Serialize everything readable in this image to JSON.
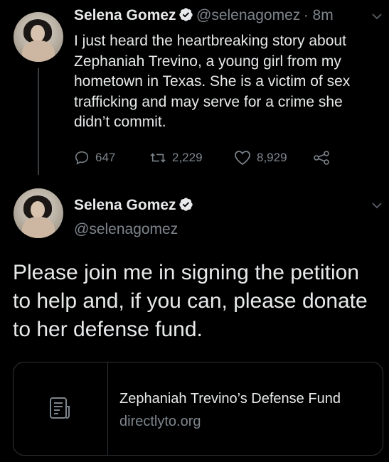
{
  "tweet1": {
    "author_name": "Selena Gomez",
    "handle": "@selenagomez",
    "time": "· 8m",
    "text": "I just heard the heartbreaking story about Zephaniah Trevino, a young girl from my hometown in Texas. She is a victim of sex trafficking and may serve for a crime she didn’t commit.",
    "replies": "647",
    "retweets": "2,229",
    "likes": "8,929"
  },
  "tweet2": {
    "author_name": "Selena Gomez",
    "handle": "@selenagomez",
    "text": "Please join me in signing the petition to help and, if you can, please donate to her defense fund.",
    "card": {
      "title": "Zephaniah Trevino’s Defense Fund",
      "domain": "directlyto.org",
      "icon": "document-icon"
    }
  },
  "colors": {
    "background": "#000000",
    "text": "#e7e9ea",
    "secondary": "#7d858c",
    "border": "#2f3336"
  }
}
